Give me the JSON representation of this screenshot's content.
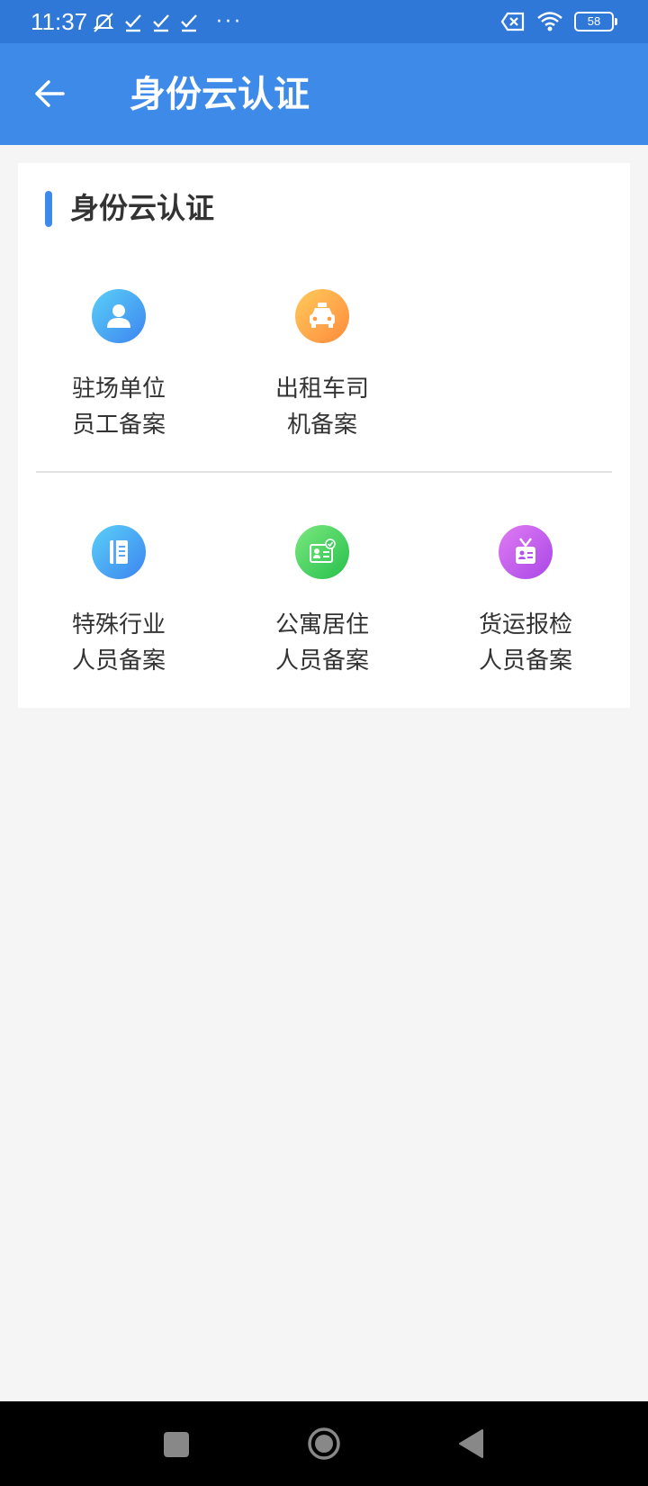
{
  "status_bar": {
    "time": "11:37",
    "battery": "58",
    "left_icons": [
      "notification-muted-icon",
      "check-icon",
      "check-icon",
      "check-icon",
      "more-dots-icon"
    ],
    "right_icons": [
      "sim-off-icon",
      "wifi-icon",
      "battery-icon"
    ],
    "more": "···"
  },
  "app_bar": {
    "title": "身份云认证",
    "back_icon": "arrow-left-icon",
    "background": "#3d8ae8"
  },
  "section": {
    "title": "身份云认证",
    "accent_color": "#3d8ae8"
  },
  "items": [
    {
      "line1": "驻场单位",
      "line2": "员工备案",
      "icon": "person-icon",
      "gradient": [
        "#5ad0f7",
        "#3d84f0"
      ]
    },
    {
      "line1": "出租车司",
      "line2": "机备案",
      "icon": "taxi-icon",
      "gradient": [
        "#ffcb5a",
        "#ff8a3d"
      ]
    },
    {
      "line1": "特殊行业",
      "line2": "人员备案",
      "icon": "notebook-icon",
      "gradient": [
        "#5ad0f7",
        "#3d84f0"
      ]
    },
    {
      "line1": "公寓居住",
      "line2": "人员备案",
      "icon": "id-card-check-icon",
      "gradient": [
        "#7be87f",
        "#26c04b"
      ]
    },
    {
      "line1": "货运报检",
      "line2": "人员备案",
      "icon": "badge-icon",
      "gradient": [
        "#e07cf3",
        "#a946e6"
      ]
    }
  ],
  "nav_bar": {
    "icons": [
      "recents-square-icon",
      "home-circle-icon",
      "back-triangle-icon"
    ]
  }
}
